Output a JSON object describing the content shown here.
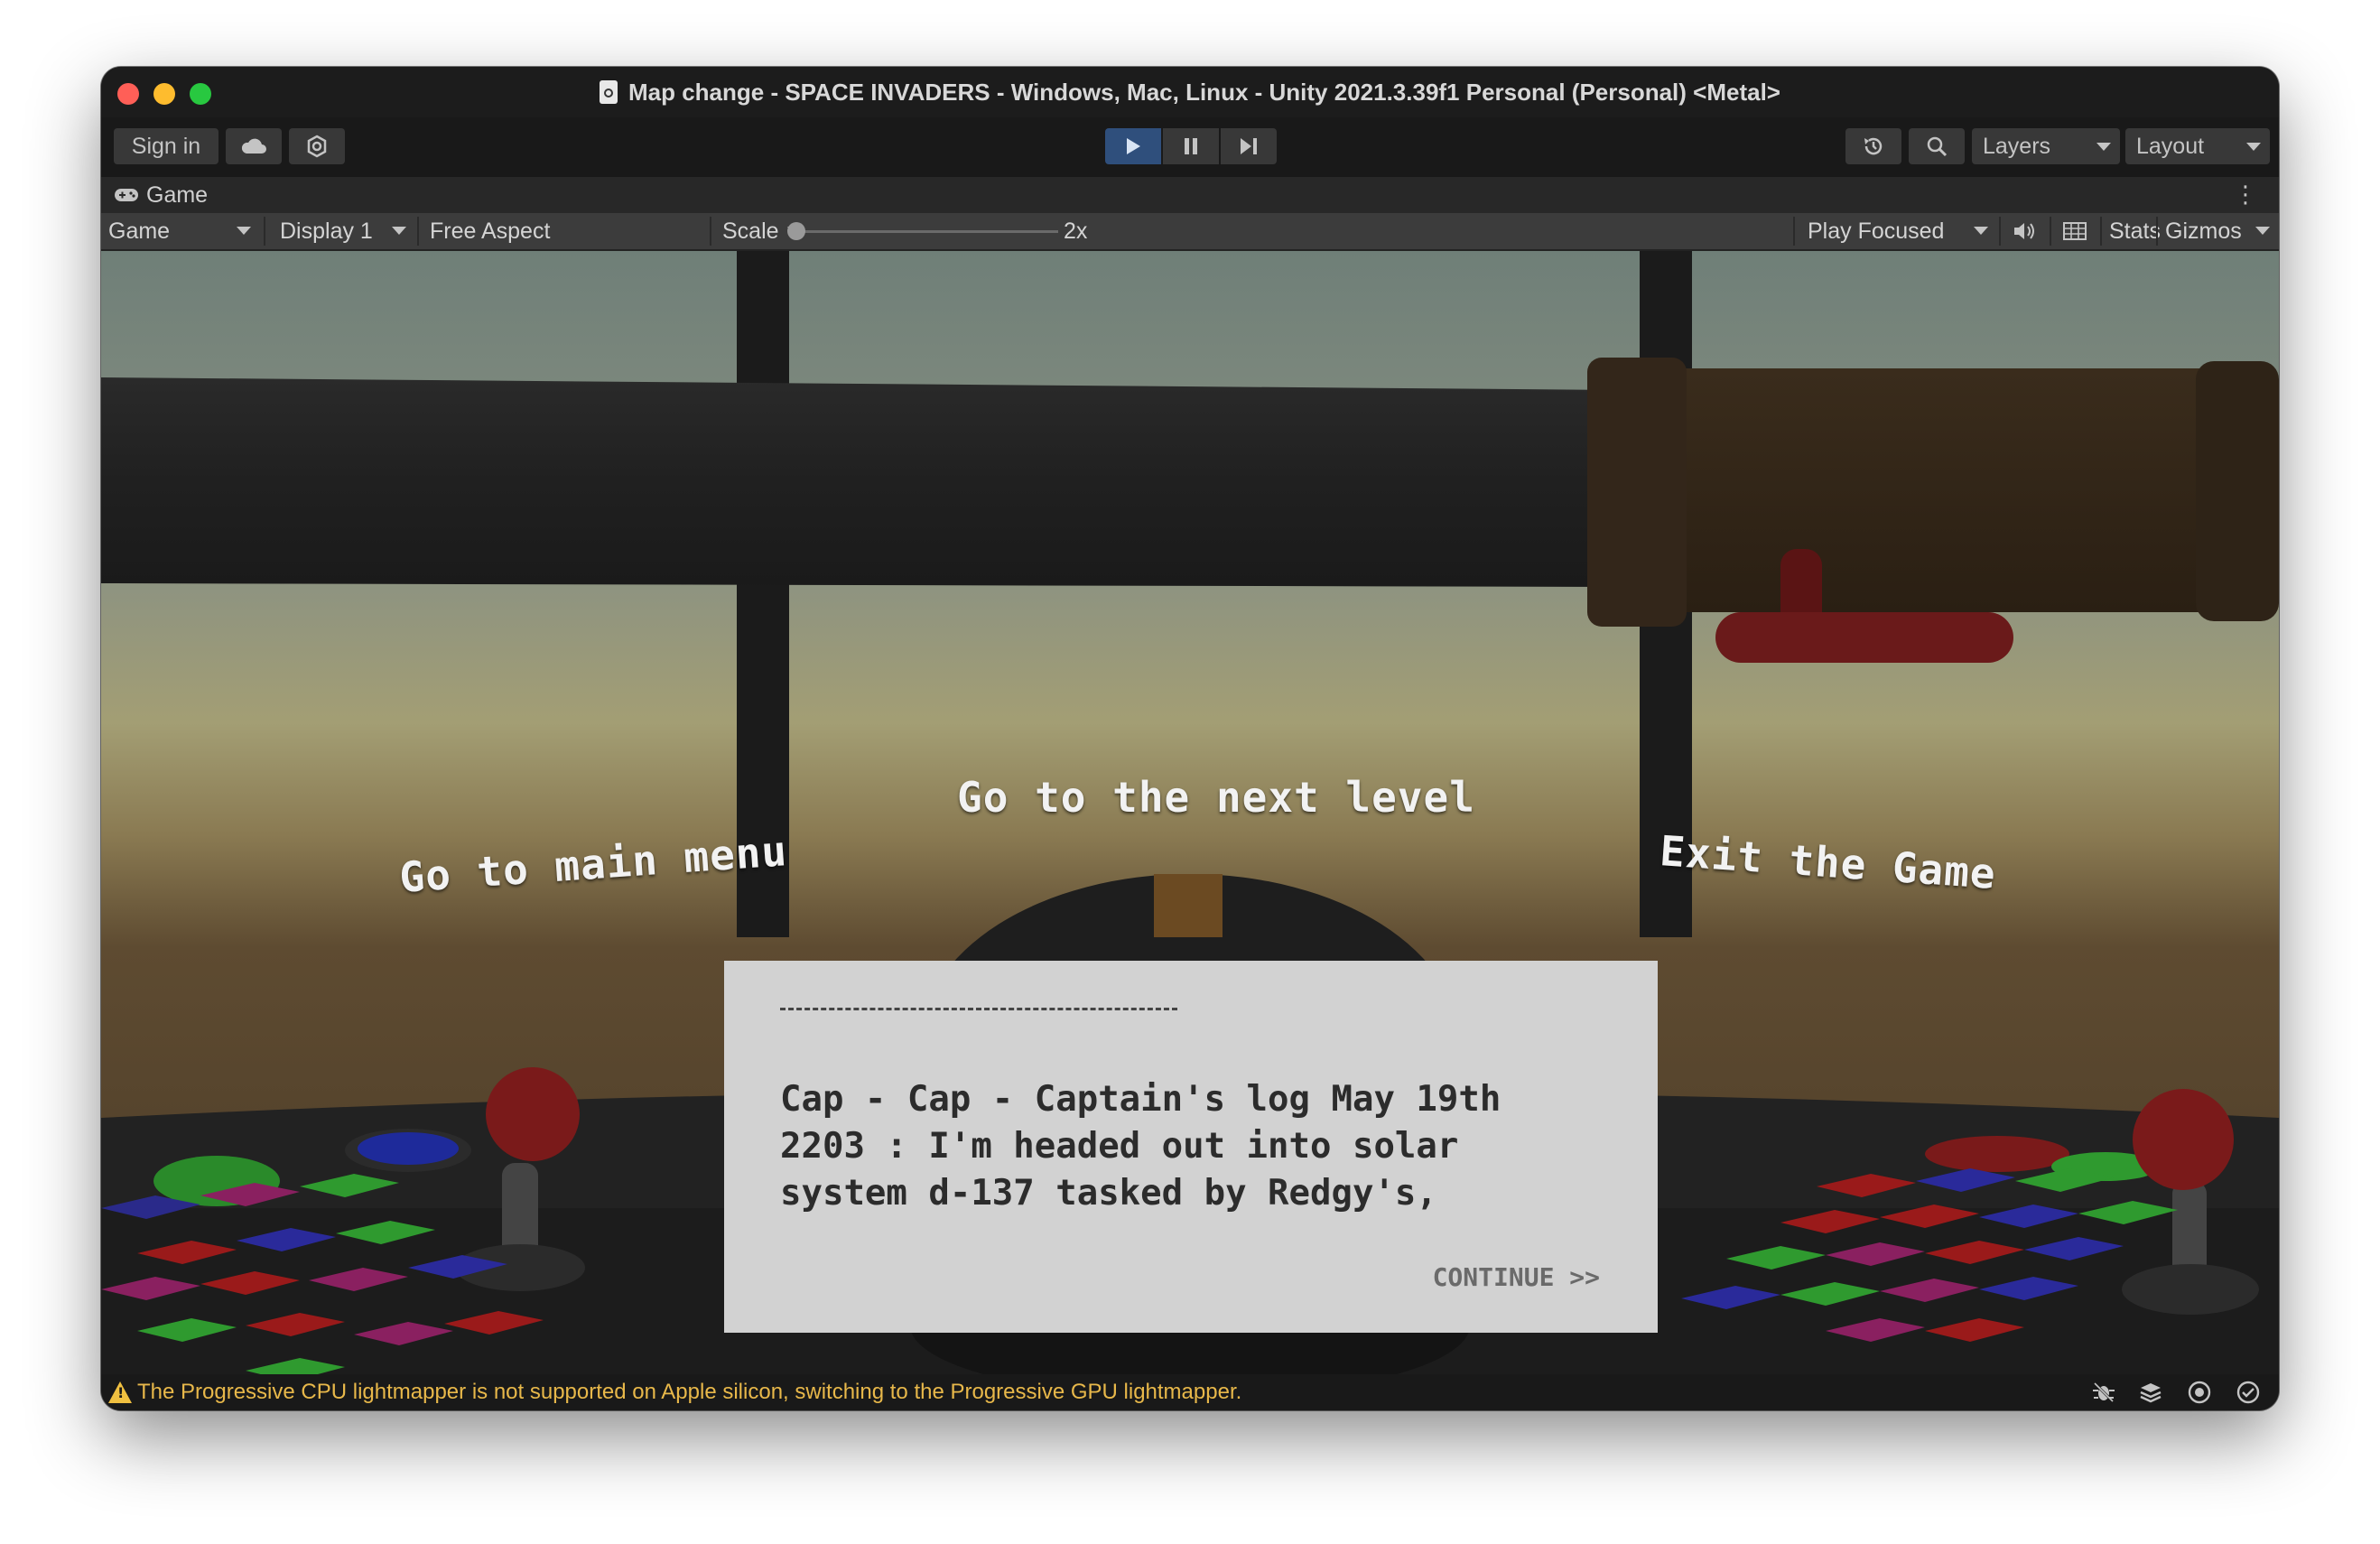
{
  "window": {
    "title": "Map change - SPACE INVADERS - Windows, Mac, Linux - Unity 2021.3.39f1 Personal (Personal) <Metal>"
  },
  "toolbar": {
    "sign_in_label": "Sign in",
    "layers_label": "Layers",
    "layout_label": "Layout",
    "icons": [
      "cloud-icon",
      "collab-icon",
      "play-icon",
      "pause-icon",
      "step-icon",
      "history-icon",
      "search-icon"
    ],
    "play_active_color": "#2f4f7c"
  },
  "game_tab": {
    "label": "Game"
  },
  "game_view_bar": {
    "view_select": "Game",
    "display_select": "Display 1",
    "aspect_select": "Free Aspect",
    "scale_label": "Scale",
    "scale_value": "2x",
    "play_mode_select": "Play Focused",
    "stats_label": "Stats",
    "gizmos_label": "Gizmos"
  },
  "game": {
    "menu_options": {
      "main_menu": "Go to main menu",
      "next_level": "Go to the next level",
      "exit_game": "Exit the Game"
    },
    "dialog": {
      "divider": "----------------------",
      "text": "Cap - Cap - Captain's log May 19th 2203 : I'm headed out into solar system d-137 tasked by Redgy's,",
      "continue_label": "CONTINUE >>"
    }
  },
  "status_bar": {
    "message": "The Progressive CPU lightmapper is not supported on Apple silicon, switching to the Progressive GPU lightmapper.",
    "message_color": "#e8b84a"
  }
}
